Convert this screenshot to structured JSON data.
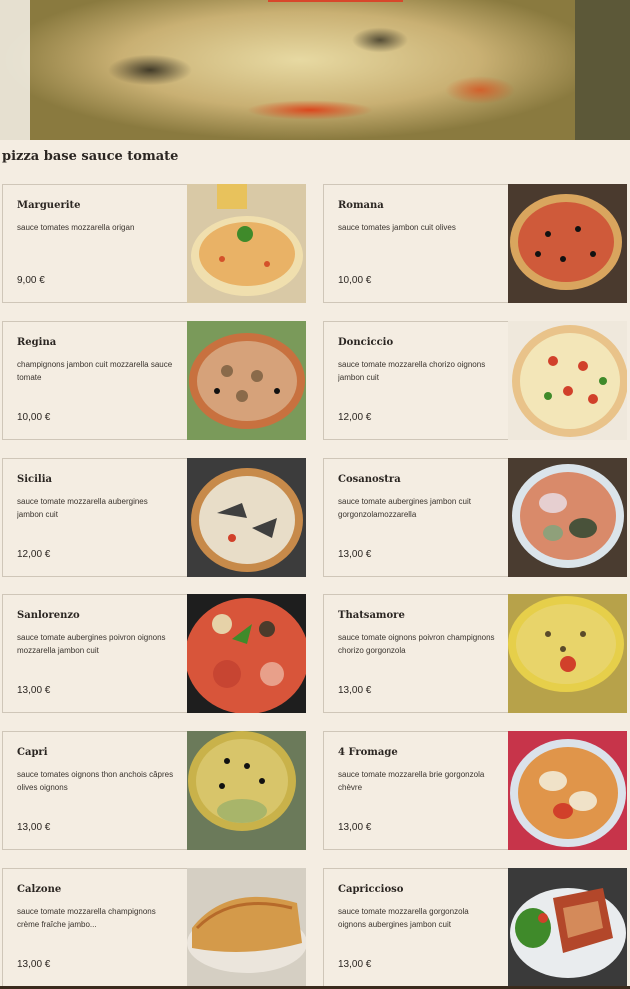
{
  "section": {
    "title": "pizza base sauce tomate"
  },
  "pizzas": [
    {
      "name": "Marguerite",
      "desc": "sauce tomates mozzarella origan",
      "price": "9,00 €"
    },
    {
      "name": "Romana",
      "desc": "sauce tomates jambon cuit olives",
      "price": "10,00 €"
    },
    {
      "name": "Regina",
      "desc": "champignons jambon cuit mozzarella sauce tomate",
      "price": "10,00 €"
    },
    {
      "name": "Donciccio",
      "desc": "sauce tomate mozzarella chorizo oignons jambon cuit",
      "price": "12,00 €"
    },
    {
      "name": "Sicilia",
      "desc": "sauce tomate mozzarella aubergines jambon cuit",
      "price": "12,00 €"
    },
    {
      "name": "Cosanostra",
      "desc": "sauce tomate aubergines jambon cuit gorgonzolamozzarella",
      "price": "13,00 €"
    },
    {
      "name": "Sanlorenzo",
      "desc": "sauce tomate aubergines poivron oignons mozzarella jambon cuit",
      "price": "13,00 €"
    },
    {
      "name": "Thatsamore",
      "desc": "sauce tomate oignons poivron champignons chorizo gorgonzola",
      "price": "13,00 €"
    },
    {
      "name": "Capri",
      "desc": "sauce tomates oignons thon anchois câpres olives oignons",
      "price": "13,00 €"
    },
    {
      "name": "4 Fromage",
      "desc": "sauce tomate mozzarella brie gorgonzola chèvre",
      "price": "13,00 €"
    },
    {
      "name": "Calzone",
      "desc": "sauce tomate mozzarella champignons crème fraîche jambo...",
      "price": "13,00 €"
    },
    {
      "name": "Capriccioso",
      "desc": "sauce tomate mozzarella gorgonzola oignons aubergines jambon cuit",
      "price": "13,00 €"
    }
  ],
  "colors": {
    "background": "#f4ede2",
    "border": "#cfc6b8",
    "text": "#2b2622"
  }
}
